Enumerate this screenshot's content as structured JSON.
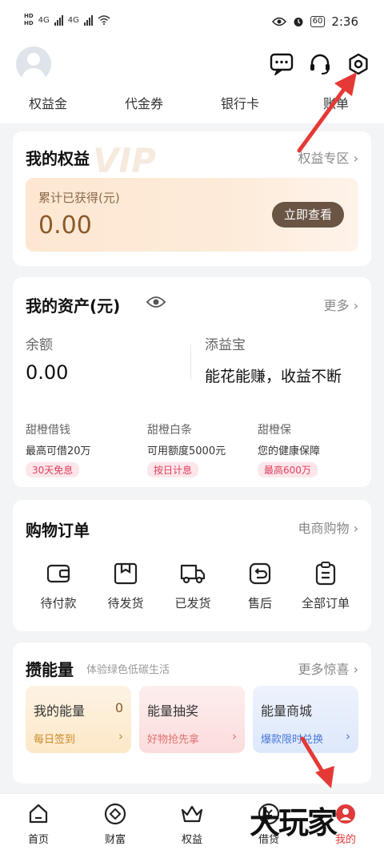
{
  "status_bar": {
    "time": "2:36",
    "battery": "60",
    "network_left": "4G",
    "network_right": "4G"
  },
  "quick_tabs": [
    "权益金",
    "代金券",
    "银行卡",
    "账单"
  ],
  "rights": {
    "title": "我的权益",
    "more": "权益专区",
    "label": "累计已获得(元)",
    "value": "0.00",
    "button": "立即查看",
    "watermark": "VIP"
  },
  "assets": {
    "title": "我的资产(元)",
    "more": "更多",
    "balance_label": "余额",
    "balance_value": "0.00",
    "tianyibao_label": "添益宝",
    "tianyibao_slogan": "能花能赚，收益不断",
    "products": [
      {
        "name": "甜橙借钱",
        "desc": "最高可借20万",
        "tag": "30天免息"
      },
      {
        "name": "甜橙白条",
        "desc": "可用额度5000元",
        "tag": "按日计息"
      },
      {
        "name": "甜橙保",
        "desc": "您的健康保障",
        "tag": "最高600万"
      }
    ]
  },
  "orders": {
    "title": "购物订单",
    "more": "电商购物",
    "items": [
      {
        "label": "待付款",
        "icon": "wallet-icon"
      },
      {
        "label": "待发货",
        "icon": "box-icon"
      },
      {
        "label": "已发货",
        "icon": "truck-icon"
      },
      {
        "label": "售后",
        "icon": "return-icon"
      },
      {
        "label": "全部订单",
        "icon": "list-icon"
      }
    ]
  },
  "energy": {
    "title": "攒能量",
    "subtitle": "体验绿色低碳生活",
    "more": "更多惊喜",
    "boxes": [
      {
        "title": "我的能量",
        "num": "0",
        "sub": "每日签到"
      },
      {
        "title": "能量抽奖",
        "num": "",
        "sub": "好物抢先拿"
      },
      {
        "title": "能量商城",
        "num": "",
        "sub": "爆款限时兑换"
      }
    ]
  },
  "bottom_nav": [
    {
      "label": "首页",
      "icon": "home-icon"
    },
    {
      "label": "财富",
      "icon": "wealth-icon"
    },
    {
      "label": "权益",
      "icon": "crown-icon"
    },
    {
      "label": "借贷",
      "icon": "loan-icon"
    },
    {
      "label": "我的",
      "icon": "profile-icon"
    }
  ],
  "watermark_text": "大玩家",
  "colors": {
    "accent_red": "#e03a3a",
    "arrow_red": "#e53935",
    "gold_text": "#8a5a2a",
    "button_dark": "#6a5444"
  }
}
